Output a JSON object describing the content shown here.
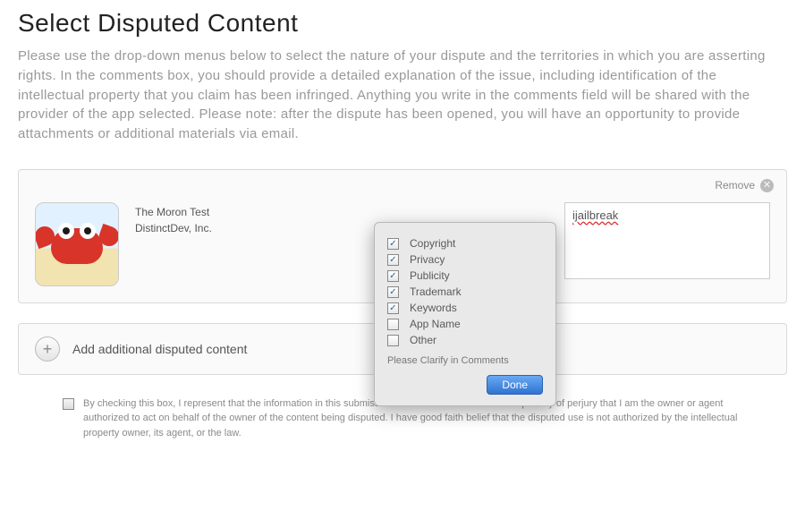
{
  "page": {
    "title": "Select Disputed Content",
    "intro": "Please use the drop-down menus below to select the nature of your dispute and the territories in which you are asserting rights. In the comments box, you should provide a detailed explanation of the issue, including identification of the intellectual property that you claim has been infringed. Anything you write in the comments field will be shared with the provider of the app selected. Please note: after the dispute has been opened, you will have an opportunity to provide attachments or additional materials via email."
  },
  "dispute_item": {
    "remove_label": "Remove",
    "app_name": "The Moron Test",
    "developer": "DistinctDev, Inc.",
    "comments_value": "ijailbreak"
  },
  "nature_popover": {
    "options": [
      {
        "label": "Copyright",
        "checked": true
      },
      {
        "label": "Privacy",
        "checked": true
      },
      {
        "label": "Publicity",
        "checked": true
      },
      {
        "label": "Trademark",
        "checked": true
      },
      {
        "label": "Keywords",
        "checked": true
      },
      {
        "label": "App Name",
        "checked": false
      },
      {
        "label": "Other",
        "checked": false
      }
    ],
    "clarify_text": "Please Clarify in Comments",
    "done_label": "Done"
  },
  "add_row": {
    "label": "Add additional disputed content"
  },
  "affirmation": {
    "checked": false,
    "text": "By checking this box, I represent that the information in this submission is accurate and swear under penalty of perjury that I am the owner or agent authorized to act on behalf of the owner of the content being disputed. I have good faith belief that the disputed use is not authorized by the intellectual property owner, its agent, or the law."
  }
}
